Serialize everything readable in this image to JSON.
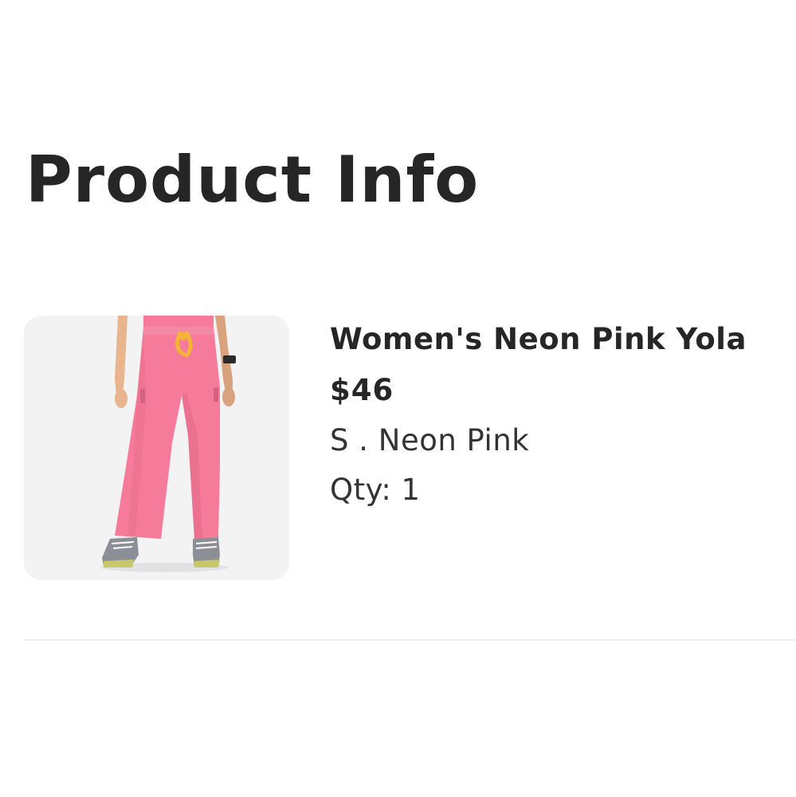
{
  "page": {
    "title": "Product Info"
  },
  "product": {
    "name": "Women's Neon Pink Yola",
    "price": "$46",
    "size": "S",
    "separator": ".",
    "color": "Neon Pink",
    "variant_text": "S . Neon Pink",
    "qty_label": "Qty:",
    "qty_value": "1",
    "qty_text": "Qty: 1",
    "image_description_icon": "product-photo",
    "colors": {
      "pant": "#f67b9b",
      "drawstring": "#f4b43a",
      "thumb_bg": "#f3f3f4"
    }
  }
}
